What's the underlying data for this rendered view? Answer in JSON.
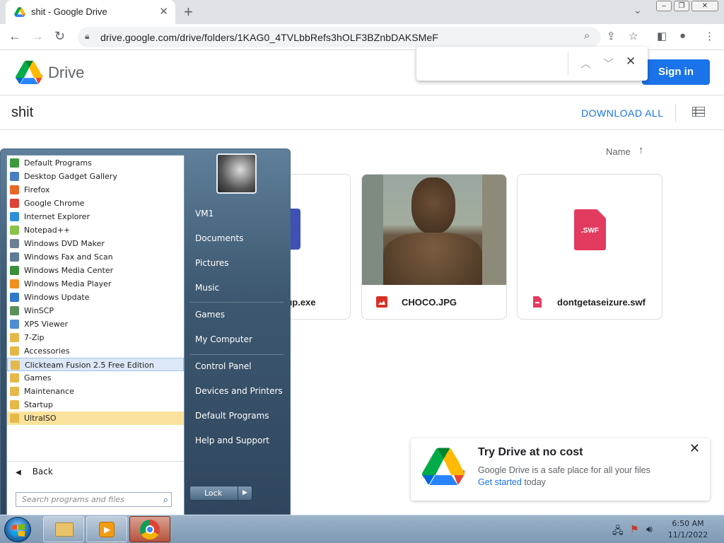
{
  "browser": {
    "tab_title": "shit - Google Drive",
    "tab_close": "✕",
    "new_tab": "+",
    "tab_dropdown": "⌄",
    "url": "drive.google.com/drive/folders/1KAG0_4TVLbbRefs3hOLF3BZnbDAKSMeF"
  },
  "drive": {
    "app_name": "Drive",
    "sign_in": "Sign in",
    "folder_name": "shit",
    "download_all": "DOWNLOAD ALL",
    "sort_label": "Name",
    "files": [
      {
        "name": "tup.exe"
      },
      {
        "name": "CHOCO.JPG"
      },
      {
        "name": "dontgetaseizure.swf",
        "thumb_text": ".SWF"
      }
    ]
  },
  "promo": {
    "title": "Try Drive at no cost",
    "line1": "Google Drive is a safe place for all your files",
    "link": "Get started",
    "line2_rest": " today"
  },
  "startmenu": {
    "programs": [
      {
        "label": "Default Programs",
        "color": "#3c9a3c"
      },
      {
        "label": "Desktop Gadget Gallery",
        "color": "#4a7fc0"
      },
      {
        "label": "Firefox",
        "color": "#e8682a"
      },
      {
        "label": "Google Chrome",
        "color": "#db4437"
      },
      {
        "label": "Internet Explorer",
        "color": "#2e8fd8"
      },
      {
        "label": "Notepad++",
        "color": "#8bc34a"
      },
      {
        "label": "Windows DVD Maker",
        "color": "#6d7f93"
      },
      {
        "label": "Windows Fax and Scan",
        "color": "#5e7c96"
      },
      {
        "label": "Windows Media Center",
        "color": "#3a8f3a"
      },
      {
        "label": "Windows Media Player",
        "color": "#f09020"
      },
      {
        "label": "Windows Update",
        "color": "#2f79c7"
      },
      {
        "label": "WinSCP",
        "color": "#5a8f5a"
      },
      {
        "label": "XPS Viewer",
        "color": "#4d8fd1"
      },
      {
        "label": "7-Zip",
        "color": "#e5b84a"
      },
      {
        "label": "Accessories",
        "color": "#e5b84a"
      },
      {
        "label": "Clickteam Fusion 2.5 Free Edition",
        "color": "#e5b84a"
      },
      {
        "label": "Games",
        "color": "#e5b84a"
      },
      {
        "label": "Maintenance",
        "color": "#e5b84a"
      },
      {
        "label": "Startup",
        "color": "#e5b84a"
      },
      {
        "label": "UltraISO",
        "color": "#e5b84a"
      }
    ],
    "back": "Back",
    "search_placeholder": "Search programs and files",
    "right_links": [
      "VM1",
      "Documents",
      "Pictures",
      "Music",
      "Games",
      "My Computer",
      "Control Panel",
      "Devices and Printers",
      "Default Programs",
      "Help and Support"
    ],
    "lock": "Lock"
  },
  "taskbar": {
    "time": "6:50 AM",
    "date": "11/1/2022"
  },
  "colors": {
    "accent": "#1a73e8",
    "selected_program": "#dce8f7",
    "highlighted_program": "#fbe29c"
  }
}
